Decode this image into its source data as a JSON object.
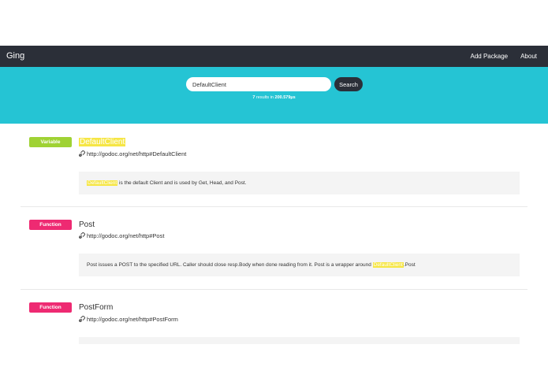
{
  "app": {
    "brand": "Ging",
    "nav": [
      "Add Package",
      "About"
    ]
  },
  "search": {
    "value": "DefaultClient",
    "button_label": "Search",
    "summary_count": "7",
    "summary_mid": " results in ",
    "summary_time": "200.579µs"
  },
  "results": [
    {
      "kind": "Variable",
      "name": "DefaultClient",
      "url": "http://godoc.org/net/http#DefaultClient",
      "desc_pre": "",
      "desc_hl": "DefaultClient",
      "desc_post": " is the default Client and is used by Get, Head, and Post."
    },
    {
      "kind": "Function",
      "name": "Post",
      "url": "http://godoc.org/net/http#Post",
      "desc_pre": "Post issues a POST to the specified URL. Caller should close resp.Body when done reading from it. Post is a wrapper around ",
      "desc_hl": "DefaultClient",
      "desc_post": ".Post"
    },
    {
      "kind": "Function",
      "name": "PostForm",
      "url": "http://godoc.org/net/http#PostForm"
    }
  ],
  "colors": {
    "navbar": "#2b2f38",
    "hero": "#25c4d4",
    "variable_badge": "#9fd234",
    "function_badge": "#ee2a72",
    "highlight": "#f6e645"
  },
  "icons": {
    "url_link": "link-icon"
  }
}
